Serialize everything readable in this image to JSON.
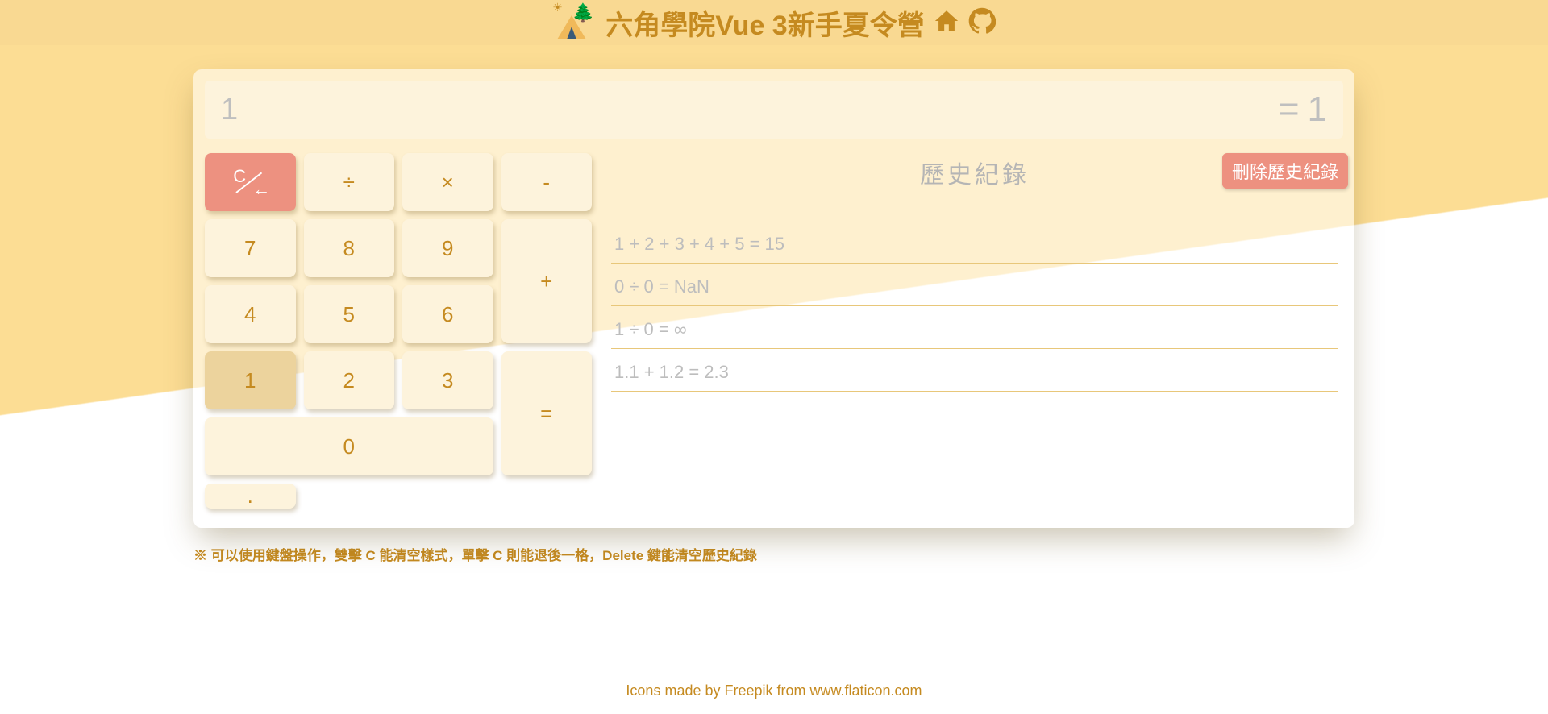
{
  "header": {
    "title": "六角學院Vue 3新手夏令營",
    "logo_name": "camp-logo",
    "home_name": "home-icon",
    "github_name": "github-icon"
  },
  "display": {
    "expression": "1",
    "equals": "=",
    "result": "1"
  },
  "keypad": {
    "clear": "C",
    "back_arrow": "←",
    "divide": "÷",
    "multiply": "×",
    "minus": "-",
    "plus": "+",
    "equals": "=",
    "dot": ".",
    "n7": "7",
    "n8": "8",
    "n9": "9",
    "n4": "4",
    "n5": "5",
    "n6": "6",
    "n1": "1",
    "n2": "2",
    "n3": "3",
    "n0": "0",
    "active_key": "1"
  },
  "history": {
    "title": "歷史紀錄",
    "clear_label": "刪除歷史紀錄",
    "items": [
      "1 + 2 + 3 + 4 + 5 = 15",
      "0 ÷ 0 = NaN",
      "1 ÷ 0 = ∞",
      "1.1 + 1.2 = 2.3"
    ]
  },
  "note": "※ 可以使用鍵盤操作，雙擊 C 能清空樣式，單擊 C 則能退後一格，Delete 鍵能清空歷史紀錄",
  "footer": "Icons made by Freepik from www.flaticon.com"
}
